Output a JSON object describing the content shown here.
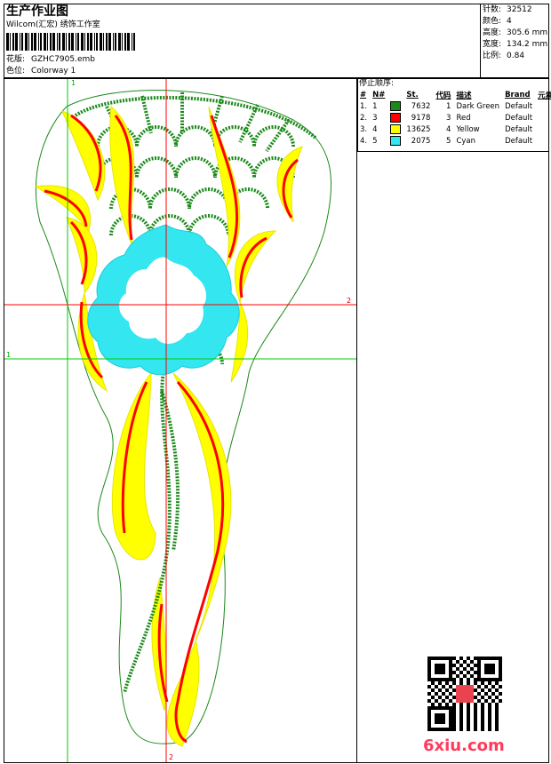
{
  "header": {
    "title": "生产作业图",
    "subtitle": "Wilcom(汇宏) 绣饰工作室",
    "design_label": "花版:",
    "design_value": "GZHC7905.emb",
    "colorway_label": "色位:",
    "colorway_value": "Colorway 1"
  },
  "stats": [
    {
      "label": "针数:",
      "value": "32512"
    },
    {
      "label": "颜色:",
      "value": "4"
    },
    {
      "label": "高度:",
      "value": "305.6 mm"
    },
    {
      "label": "宽度:",
      "value": "134.2 mm"
    },
    {
      "label": "比例:",
      "value": "0.84"
    }
  ],
  "stop_sequence": {
    "heading": "停止顺序:",
    "columns": [
      "#",
      "N#",
      "St.",
      "代码",
      "描述",
      "Brand",
      "元素"
    ],
    "rows": [
      {
        "idx": "1.",
        "n": "1",
        "color": "#1a8a1a",
        "st": "7632",
        "code": "1",
        "desc": "Dark Green",
        "brand": "Default"
      },
      {
        "idx": "2.",
        "n": "3",
        "color": "#ff0000",
        "st": "9178",
        "code": "3",
        "desc": "Red",
        "brand": "Default"
      },
      {
        "idx": "3.",
        "n": "4",
        "color": "#ffff00",
        "st": "13625",
        "code": "4",
        "desc": "Yellow",
        "brand": "Default"
      },
      {
        "idx": "4.",
        "n": "5",
        "color": "#33e6f0",
        "st": "2075",
        "code": "5",
        "desc": "Cyan",
        "brand": "Default"
      }
    ]
  },
  "guides": {
    "v1": "1",
    "h1": "1",
    "v2": "2",
    "h2": "2"
  },
  "watermark": "6xiu.com"
}
